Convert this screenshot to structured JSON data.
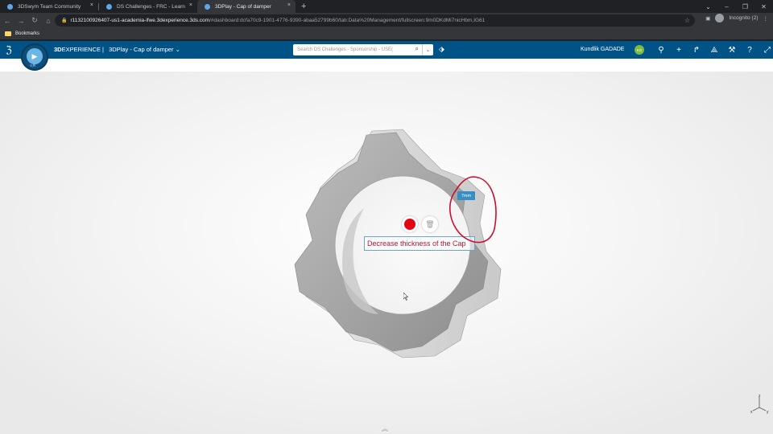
{
  "browser": {
    "tabs": [
      {
        "title": "3DSwym Team Community",
        "active": false
      },
      {
        "title": "DS Challenges - FRC - Learn",
        "active": false
      },
      {
        "title": "3DPlay - Cap of damper",
        "active": true
      }
    ],
    "tab_close_glyph": "×",
    "new_tab_glyph": "+",
    "url_host": "r1132100926407-us1-academia-ifwe.3dexperience.3ds.com",
    "url_path": "/#dashboard:dcfa70c9-1901-4776-9390-abaa52799b60/tab:Data%20Management/fullscreen:9m0DKdMi7nicHbm,IG61",
    "incognito_label": "Incognito (2)",
    "bookmarks_label": "Bookmarks"
  },
  "app": {
    "brand_bold": "3D",
    "brand_rest": "EXPERIENCE |",
    "app_title": "3DPlay - Cap of damper",
    "compass_label": "V,R",
    "search_placeholder": "Search DS Challenges - Sponsorship - USE(",
    "user_name": "Kundlik GADADE",
    "user_initials": "KG"
  },
  "viewer": {
    "note_text": "Decrease thickness of the Cap",
    "dimension_label": "7mm",
    "triad": {
      "z": "z",
      "x": "x",
      "y": "y"
    }
  },
  "colors": {
    "ds_bar": "#005386",
    "marker_red": "#e30613",
    "note_text": "#c8102e",
    "dimension_tag": "#368ec4"
  }
}
